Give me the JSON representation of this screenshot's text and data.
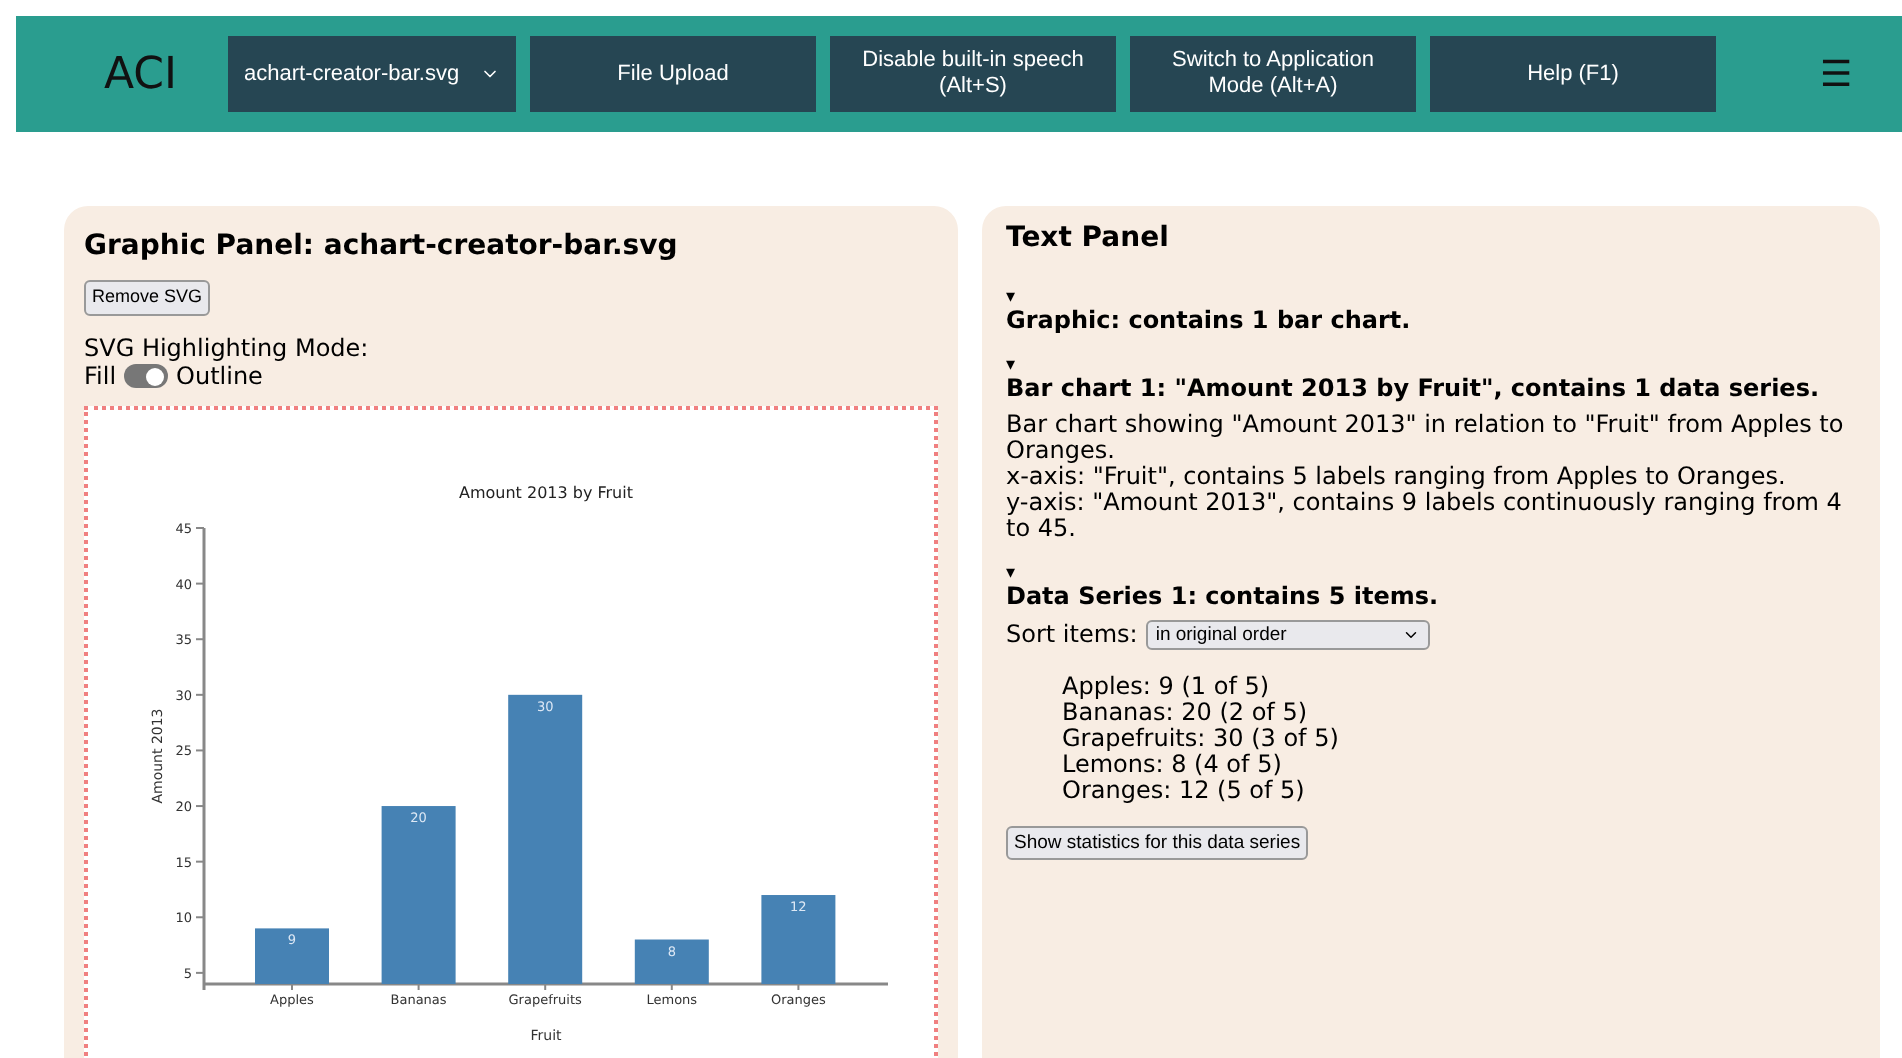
{
  "header": {
    "logo": "ACI",
    "file_select": {
      "value": "achart-creator-bar.svg"
    },
    "buttons": [
      "File Upload",
      "Disable built-in speech (Alt+S)",
      "Switch to Application Mode (Alt+A)",
      "Help (F1)"
    ],
    "menu_icon": "☰"
  },
  "graphic_panel": {
    "title": "Graphic Panel: achart-creator-bar.svg",
    "remove_button": "Remove SVG",
    "mode_label": "SVG Highlighting Mode:",
    "toggle": {
      "left_label": "Fill",
      "right_label": "Outline",
      "on": true
    },
    "chart_data": {
      "type": "bar",
      "title": "Amount 2013 by Fruit",
      "xlabel": "Fruit",
      "ylabel": "Amount 2013",
      "categories": [
        "Apples",
        "Bananas",
        "Grapefruits",
        "Lemons",
        "Oranges"
      ],
      "series": [
        {
          "color": "#4682b4",
          "values": [
            9,
            20,
            30,
            8,
            12
          ]
        }
      ],
      "ylim": [
        4,
        45
      ],
      "yticks": [
        5,
        10,
        15,
        20,
        25,
        30,
        35,
        40,
        45
      ],
      "data_labels": true
    }
  },
  "text_panel": {
    "title": "Text Panel",
    "sections": [
      {
        "marker": "▾",
        "heading": "Graphic: contains 1 bar chart.",
        "expanded": true
      },
      {
        "marker": "▾",
        "heading": "Bar chart 1: \"Amount 2013 by Fruit\", contains 1 data series.",
        "expanded": true,
        "lines": [
          "Bar chart showing \"Amount 2013\" in relation to \"Fruit\" from Apples to Oranges.",
          "x-axis: \"Fruit\", contains 5 labels ranging from Apples to Oranges.",
          "y-axis: \"Amount 2013\", contains 9 labels continuously ranging from 4 to 45."
        ]
      },
      {
        "marker": "▾",
        "heading": "Data Series 1: contains 5 items.",
        "expanded": true,
        "sort_label": "Sort items:",
        "sort_value": "in original order",
        "items": [
          "Apples: 9 (1 of 5)",
          "Bananas: 20 (2 of 5)",
          "Grapefruits: 30 (3 of 5)",
          "Lemons: 8 (4 of 5)",
          "Oranges: 12 (5 of 5)"
        ],
        "stats_button": "Show statistics for this data series"
      }
    ]
  }
}
